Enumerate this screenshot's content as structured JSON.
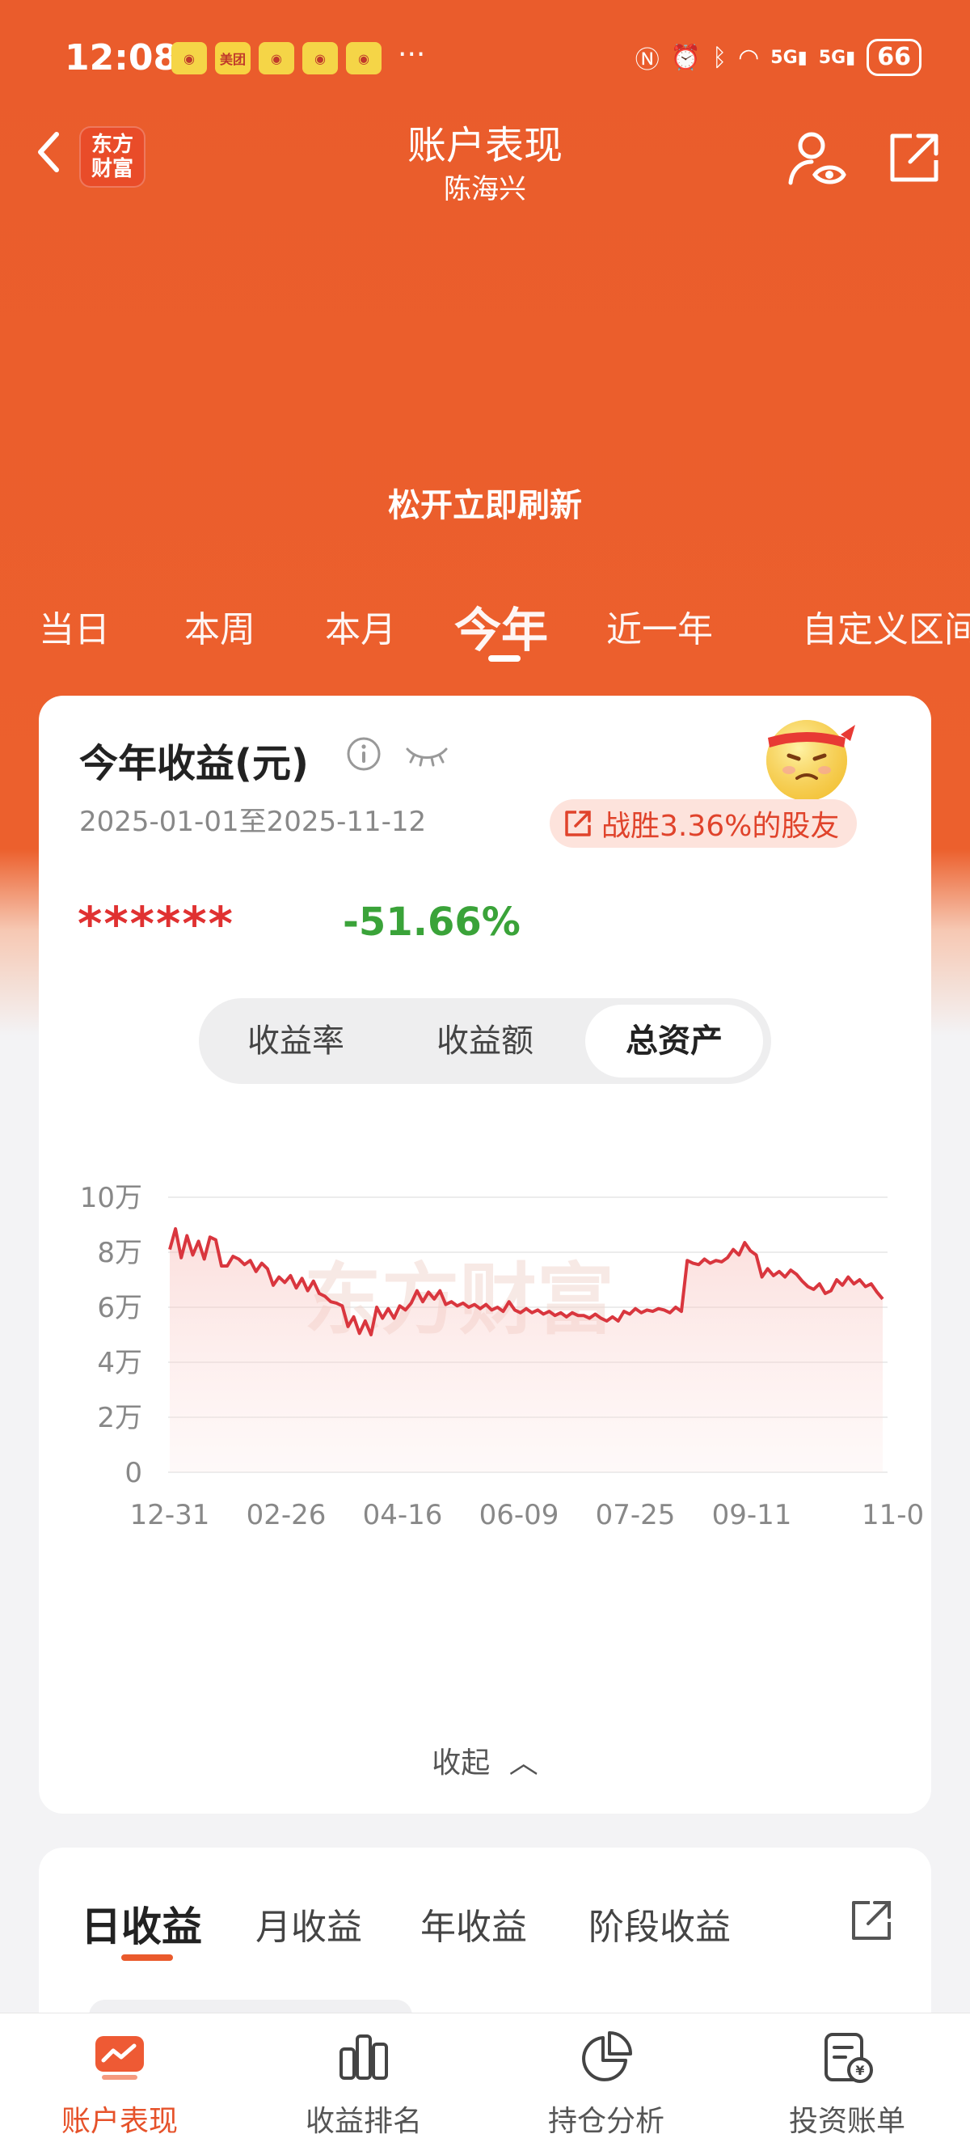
{
  "status_bar": {
    "time": "12:08",
    "app_icons": [
      "weibo",
      "美团",
      "weibo",
      "weibo",
      "weibo"
    ],
    "more": "···",
    "signal_1": "5G",
    "signal_2": "5G",
    "battery": "66"
  },
  "header": {
    "logo_line1": "东方",
    "logo_line2": "财富",
    "title": "账户表现",
    "subtitle": "陈海兴"
  },
  "refresh_hint": "松开立即刷新",
  "period_tabs": [
    {
      "label": "当日",
      "active": false
    },
    {
      "label": "本周",
      "active": false
    },
    {
      "label": "本月",
      "active": false
    },
    {
      "label": "今年",
      "active": true
    },
    {
      "label": "近一年",
      "active": false
    },
    {
      "label": "自定义区间",
      "active": false
    }
  ],
  "summary": {
    "title": "今年收益(元)",
    "date_range": "2025-01-01至2025-11-12",
    "beat_text": "战胜3.36%的股友",
    "masked_amount": "******",
    "return_pct": "-51.66%"
  },
  "segments": [
    {
      "label": "收益率",
      "active": false
    },
    {
      "label": "收益额",
      "active": false
    },
    {
      "label": "总资产",
      "active": true
    }
  ],
  "watermark": "东方财富",
  "collapse_label": "收起",
  "colors": {
    "brand_orange": "#ea5c2c",
    "line_red": "#d9363e",
    "negative_green": "#3aa339",
    "active_nav": "#e6522a"
  },
  "chart_data": {
    "type": "area",
    "ylim": [
      0,
      100000
    ],
    "y_ticks": [
      "0",
      "2万",
      "4万",
      "6万",
      "8万",
      "10万"
    ],
    "y_tick_values": [
      0,
      20000,
      40000,
      60000,
      80000,
      100000
    ],
    "x_ticks": [
      "12-31",
      "02-26",
      "04-16",
      "06-09",
      "07-25",
      "09-11",
      "11-0"
    ],
    "grid": true,
    "series": [
      {
        "values": [
          81000,
          88500,
          78000,
          86000,
          79000,
          84000,
          77500,
          85500,
          84500,
          75000,
          75000,
          78500,
          77500,
          75500,
          77000,
          73000,
          76000,
          74000,
          68000,
          71000,
          69000,
          71500,
          67000,
          70500,
          66000,
          69500,
          65000,
          64000,
          62000,
          61500,
          60500,
          53000,
          56500,
          50500,
          55000,
          50000,
          60000,
          56000,
          59500,
          56000,
          60500,
          59000,
          61500,
          66000,
          62000,
          65500,
          63000,
          66000,
          61000,
          62000,
          60500,
          61500,
          60000,
          61000,
          59500,
          61000,
          59000,
          60000,
          58500,
          62000,
          59000,
          58000,
          59500,
          58000,
          59000,
          57500,
          58500,
          57000,
          58000,
          56500,
          58000,
          57000,
          57000,
          56000,
          57500,
          56000,
          55000,
          56500,
          55000,
          58500,
          57500,
          59500,
          58000,
          59000,
          58500,
          59500,
          59000,
          58000,
          60000,
          58500,
          77000,
          76000,
          75500,
          77500,
          76000,
          77000,
          76500,
          78000,
          81000,
          79000,
          83500,
          80500,
          79000,
          71000,
          74000,
          71500,
          73000,
          71000,
          73500,
          72000,
          69500,
          67500,
          66500,
          68500,
          65000,
          66000,
          70000,
          68000,
          71000,
          68500,
          70000,
          67500,
          68500,
          65500,
          63000
        ]
      }
    ]
  },
  "bottom_tabs": [
    {
      "label": "日收益",
      "active": true
    },
    {
      "label": "月收益",
      "active": false
    },
    {
      "label": "年收益",
      "active": false
    },
    {
      "label": "阶段收益",
      "active": false
    }
  ],
  "nav": [
    {
      "label": "账户表现",
      "icon": "chart-trend-icon",
      "active": true
    },
    {
      "label": "收益排名",
      "icon": "bar-chart-icon",
      "active": false
    },
    {
      "label": "持仓分析",
      "icon": "pie-chart-icon",
      "active": false
    },
    {
      "label": "投资账单",
      "icon": "bill-icon",
      "active": false
    }
  ]
}
